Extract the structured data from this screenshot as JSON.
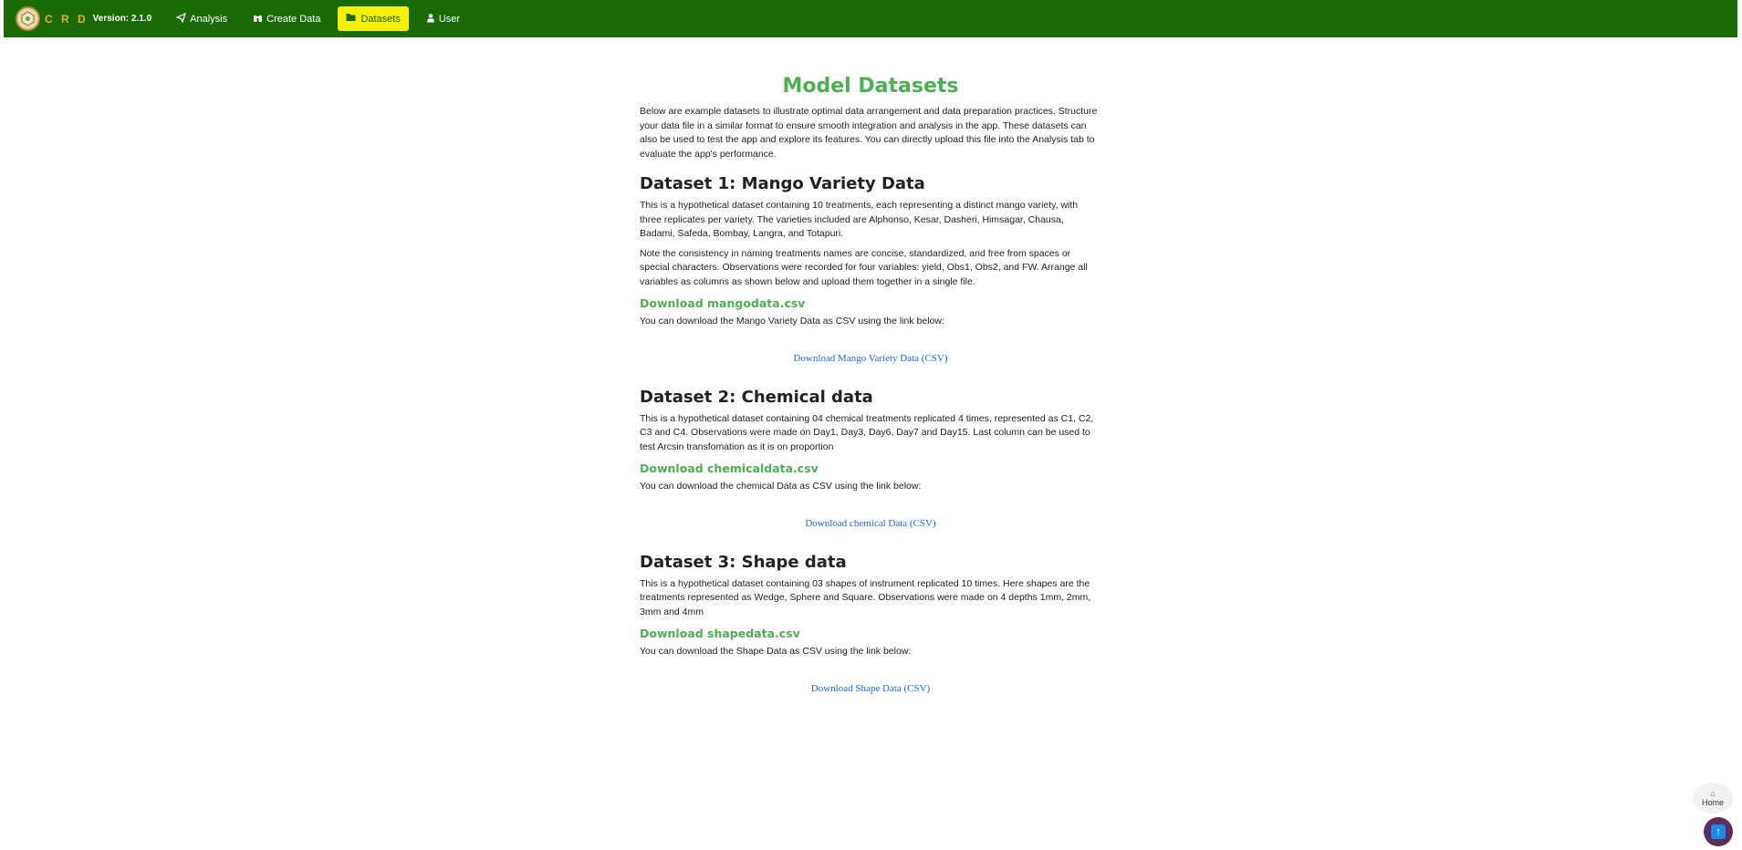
{
  "navbar": {
    "brand": "C R D",
    "version": "Version: 2.1.0",
    "items": [
      {
        "label": "Analysis",
        "icon": "paper-plane-icon"
      },
      {
        "label": "Create Data",
        "icon": "binoculars-icon"
      },
      {
        "label": "Datasets",
        "icon": "folder-open-icon",
        "active": true
      },
      {
        "label": "User",
        "icon": "user-secret-icon"
      }
    ],
    "colors": {
      "background": "#1a6b06",
      "active_bg": "#f6ee0c",
      "brand": "#f5a623"
    }
  },
  "main": {
    "title": "Model Datasets",
    "intro": "Below are example datasets to illustrate optimal data arrangement and data preparation practices. Structure your data file in a similar format to ensure smooth integration and analysis in the app. These datasets can also be used to test the app and explore its features. You can directly upload this file into the Analysis tab to evaluate the app's performance.",
    "datasets": [
      {
        "title": "Dataset 1: Mango Variety Data",
        "paragraphs": [
          "This is a hypothetical dataset containing 10 treatments, each representing a distinct mango variety, with three replicates per variety. The varieties included are Alphonso, Kesar, Dasheri, Himsagar, Chausa, Badami, Safeda, Bombay, Langra, and Totapuri.",
          "Note the consistency in naming treatments names are concise, standardized, and free from spaces or special characters. Observations were recorded for four variables: yield, Obs1, Obs2, and FW. Arrange all variables as columns as shown below and upload them together in a single file."
        ],
        "download_heading": "Download mangodata.csv",
        "download_text": "You can download the Mango Variety Data as CSV using the link below:",
        "link_label": "Download Mango Variety Data (CSV)"
      },
      {
        "title": "Dataset 2: Chemical data",
        "paragraphs": [
          "This is a hypothetical dataset containing 04 chemical treatments replicated 4 times, represented as C1, C2, C3 and C4. Observations were made on Day1, Day3, Day6, Day7 and Day15. Last column can be used to test Arcsin transfomation as it is on proportion"
        ],
        "download_heading": "Download chemicaldata.csv",
        "download_text": "You can download the chemical Data as CSV using the link below:",
        "link_label": "Download chemical Data (CSV)"
      },
      {
        "title": "Dataset 3: Shape data",
        "paragraphs": [
          "This is a hypothetical dataset containing 03 shapes of instrument replicated 10 times. Here shapes are the treatments represented as Wedge, Sphere and Square. Observations were made on 4 depths 1mm, 2mm, 3mm and 4mm"
        ],
        "download_heading": "Download shapedata.csv",
        "download_text": "You can download the Shape Data as CSV using the link below:",
        "link_label": "Download Shape Data (CSV)"
      }
    ]
  },
  "floating": {
    "home_label": "Home",
    "home_icon": "house-icon",
    "top_icon": "arrow-up-icon"
  }
}
